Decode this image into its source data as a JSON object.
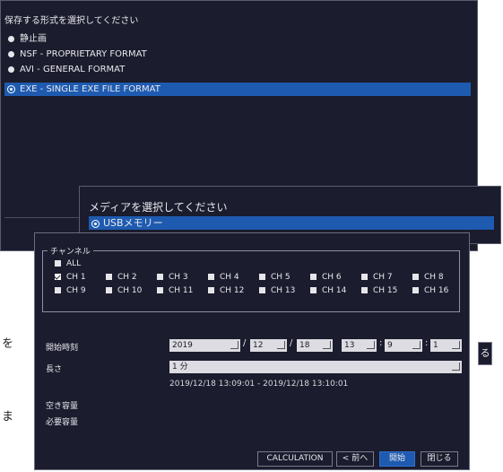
{
  "format_dialog": {
    "title": "保存する形式を選択してください",
    "options": [
      {
        "label": "静止画",
        "selected": false
      },
      {
        "label": "NSF - PROPRIETARY FORMAT",
        "selected": false
      },
      {
        "label": "AVI - GENERAL FORMAT",
        "selected": false
      },
      {
        "label": "EXE - SINGLE EXE FILE FORMAT",
        "selected": true
      }
    ]
  },
  "media_dialog": {
    "title": "メディアを選択してください",
    "option": "USBメモリー"
  },
  "side_fragments": {
    "left_1": "を",
    "left_2": "ま",
    "right_button": "る"
  },
  "export_dialog": {
    "channel_legend": "チャンネル",
    "all_label": "ALL",
    "channels_row1": [
      {
        "label": "CH 1",
        "checked": true
      },
      {
        "label": "CH 2",
        "checked": false
      },
      {
        "label": "CH 3",
        "checked": false
      },
      {
        "label": "CH 4",
        "checked": false
      },
      {
        "label": "CH 5",
        "checked": false
      },
      {
        "label": "CH 6",
        "checked": false
      },
      {
        "label": "CH 7",
        "checked": false
      },
      {
        "label": "CH 8",
        "checked": false
      }
    ],
    "channels_row2": [
      {
        "label": "CH 9",
        "checked": false
      },
      {
        "label": "CH 10",
        "checked": false
      },
      {
        "label": "CH 11",
        "checked": false
      },
      {
        "label": "CH 12",
        "checked": false
      },
      {
        "label": "CH 13",
        "checked": false
      },
      {
        "label": "CH 14",
        "checked": false
      },
      {
        "label": "CH 15",
        "checked": false
      },
      {
        "label": "CH 16",
        "checked": false
      }
    ],
    "start_label": "開始時刻",
    "start": {
      "year": "2019",
      "month": "12",
      "day": "18",
      "hour": "13",
      "minute": "9",
      "second": "1"
    },
    "length_label": "長さ",
    "length_value": "1 分",
    "range_text": "2019/12/18 13:09:01 - 2019/12/18 13:10:01",
    "free_space_label": "空き容量",
    "required_space_label": "必要容量",
    "buttons": {
      "calculation": "CALCULATION",
      "prev": "< 前へ",
      "start": "開始",
      "close": "閉じる"
    }
  }
}
